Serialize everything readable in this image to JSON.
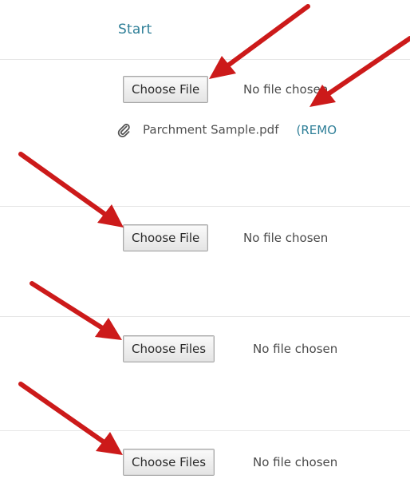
{
  "header": {
    "start_link": "Start"
  },
  "rows": [
    {
      "button_label": "Choose File",
      "status": "No file chosen",
      "attachment": {
        "icon": "paperclip-icon",
        "filename": "Parchment Sample.pdf",
        "action": "(REMO"
      }
    },
    {
      "button_label": "Choose File",
      "status": "No file chosen"
    },
    {
      "button_label": "Choose Files",
      "status": "No file chosen"
    },
    {
      "button_label": "Choose Files",
      "status": "No file chosen"
    }
  ],
  "annotations": {
    "arrow_color": "#cc1a1a",
    "arrow_count": 6
  }
}
